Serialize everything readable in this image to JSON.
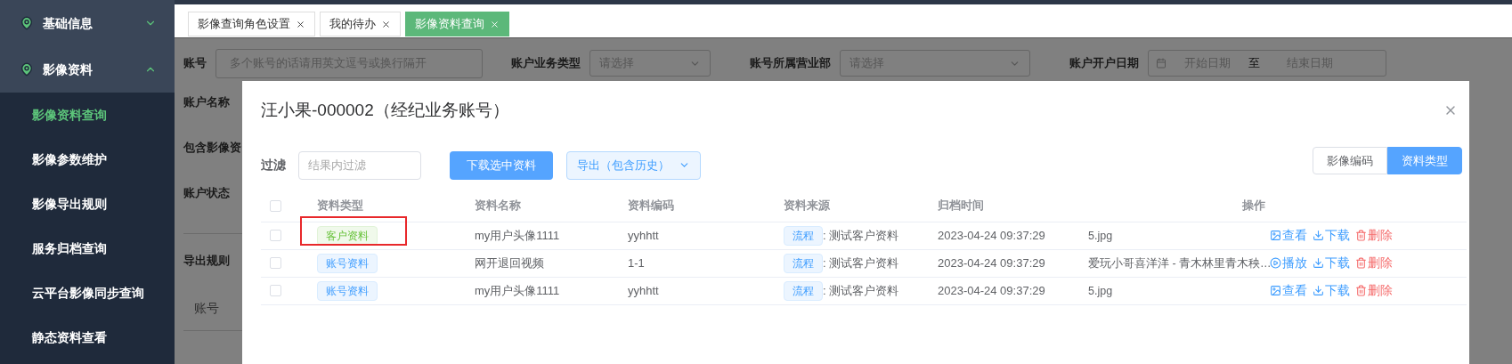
{
  "sidebar": {
    "groups": [
      {
        "label": "基础信息",
        "expanded": false
      },
      {
        "label": "影像资料",
        "expanded": true,
        "children": [
          {
            "label": "影像资料查询",
            "selected": true
          },
          {
            "label": "影像参数维护",
            "selected": false
          },
          {
            "label": "影像导出规则",
            "selected": false
          },
          {
            "label": "服务归档查询",
            "selected": false
          },
          {
            "label": "云平台影像同步查询",
            "selected": false
          },
          {
            "label": "静态资料查看",
            "selected": false
          }
        ]
      }
    ]
  },
  "tabs": [
    {
      "label": "影像查询角色设置",
      "selected": false
    },
    {
      "label": "我的待办",
      "selected": false
    },
    {
      "label": "影像资料查询",
      "selected": true
    }
  ],
  "search_form": {
    "fields": [
      {
        "kind": "textarea",
        "label": "账号",
        "placeholder": "多个账号的话请用英文逗号或换行隔开"
      },
      {
        "kind": "select",
        "label": "账户业务类型",
        "placeholder": "请选择"
      },
      {
        "kind": "select",
        "label": "账号所属营业部",
        "placeholder": "请选择"
      },
      {
        "kind": "daterange",
        "label": "账户开户日期",
        "start_placeholder": "开始日期",
        "separator": "至",
        "end_placeholder": "结束日期"
      }
    ],
    "labels": [
      "账户名称",
      "包含影像资",
      "账户状态",
      "导出规则"
    ],
    "table_column": "账号"
  },
  "dialog": {
    "title": "汪小果-000002（经纪业务账号）",
    "filter": {
      "label": "过滤",
      "placeholder": "结果内过滤"
    },
    "download_button": "下载选中资料",
    "export_button": "导出（包含历史）",
    "view_toggle": [
      {
        "label": "影像编码",
        "selected": false
      },
      {
        "label": "资料类型",
        "selected": true
      }
    ],
    "table": {
      "all_checked": false,
      "columns": [
        "资料类型",
        "资料名称",
        "资料编码",
        "资料来源",
        "归档时间",
        "操作"
      ],
      "rows": [
        {
          "checked": false,
          "type": {
            "label": "客户资料",
            "kind": "success"
          },
          "highlighted": true,
          "name": "my用户头像1111",
          "code": "yyhhtt",
          "source_tag": "流程",
          "source": ": 测试客户资料",
          "time": "2023-04-24 09:37:29",
          "file": "5.jpg",
          "actions": [
            {
              "kind": "view",
              "label": "查看"
            },
            {
              "kind": "download",
              "label": "下载"
            },
            {
              "kind": "delete",
              "label": "删除"
            }
          ]
        },
        {
          "checked": false,
          "type": {
            "label": "账号资料",
            "kind": "primary"
          },
          "highlighted": false,
          "name": "网开退回视频",
          "code": "1-1",
          "source_tag": "流程",
          "source": ": 测试客户资料",
          "time": "2023-04-24 09:37:29",
          "file": "爱玩小哥喜洋洋 - 青木林里青木秧…",
          "actions": [
            {
              "kind": "play",
              "label": "播放"
            },
            {
              "kind": "download",
              "label": "下载"
            },
            {
              "kind": "delete",
              "label": "删除"
            }
          ]
        },
        {
          "checked": false,
          "type": {
            "label": "账号资料",
            "kind": "primary"
          },
          "highlighted": false,
          "name": "my用户头像1111",
          "code": "yyhhtt",
          "source_tag": "流程",
          "source": ": 测试客户资料",
          "time": "2023-04-24 09:37:29",
          "file": "5.jpg",
          "actions": [
            {
              "kind": "view",
              "label": "查看"
            },
            {
              "kind": "download",
              "label": "下载"
            },
            {
              "kind": "delete",
              "label": "删除"
            }
          ]
        }
      ]
    }
  }
}
